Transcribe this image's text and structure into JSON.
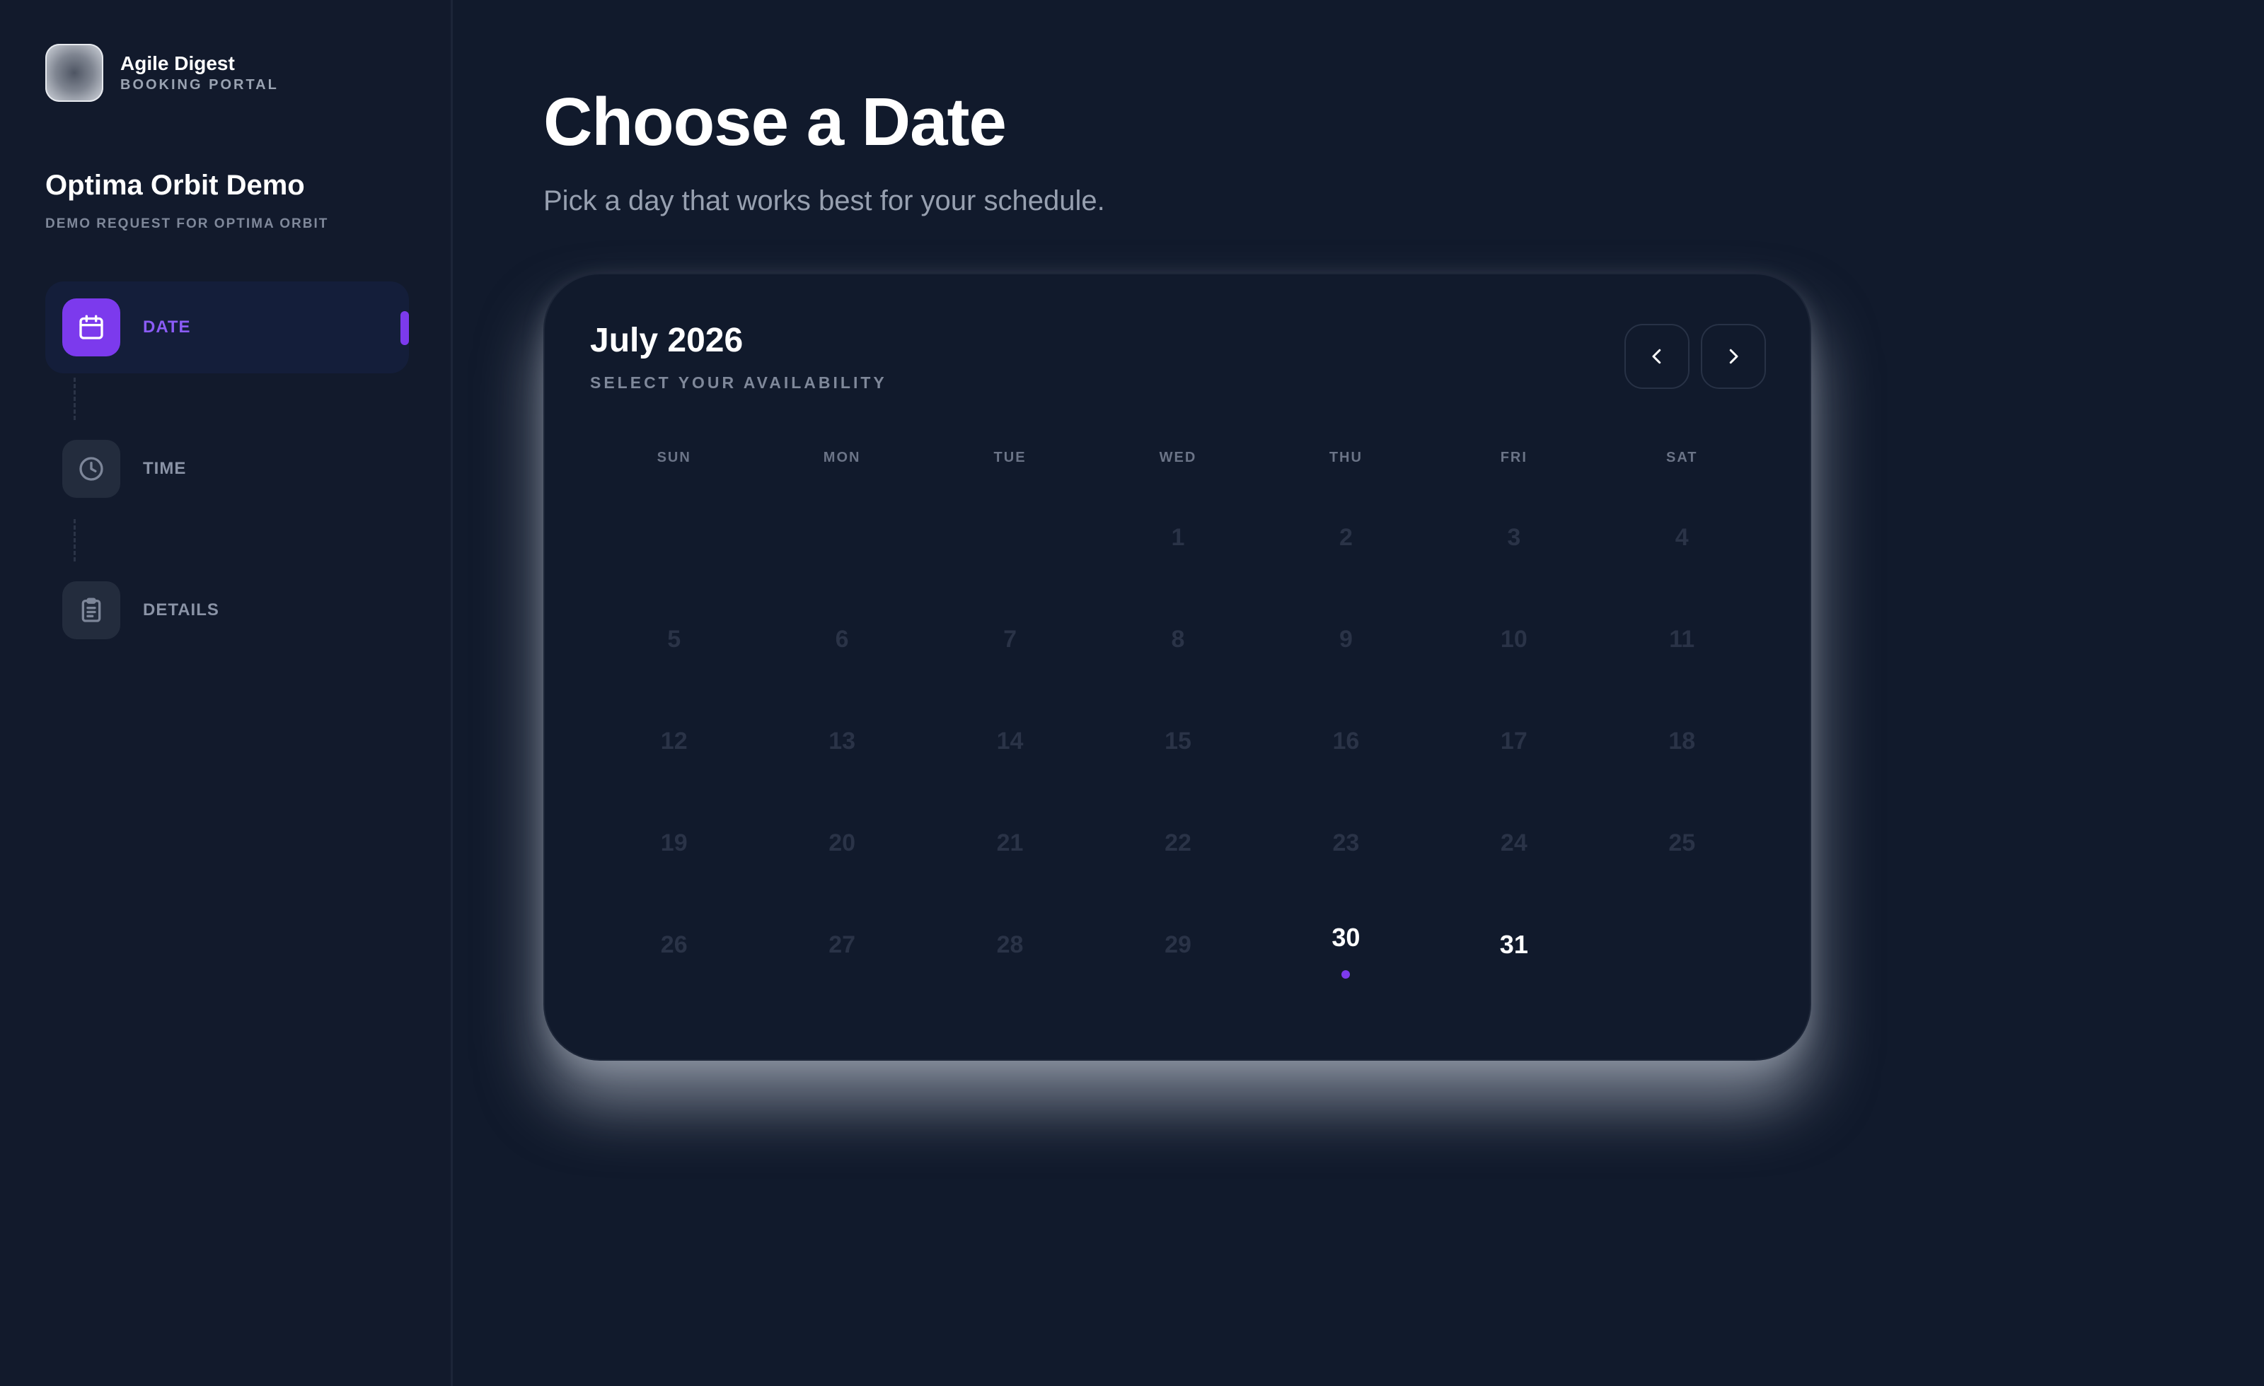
{
  "brand": {
    "name": "Agile Digest",
    "subtitle": "BOOKING PORTAL"
  },
  "event": {
    "title": "Optima Orbit Demo",
    "subtitle": "DEMO REQUEST FOR OPTIMA ORBIT"
  },
  "steps": [
    {
      "label": "DATE",
      "icon": "calendar-icon",
      "active": true
    },
    {
      "label": "TIME",
      "icon": "clock-icon",
      "active": false
    },
    {
      "label": "DETAILS",
      "icon": "clipboard-icon",
      "active": false
    }
  ],
  "page": {
    "title": "Choose a Date",
    "subtitle": "Pick a day that works best for your schedule."
  },
  "calendar": {
    "month_label": "July 2026",
    "subtitle": "SELECT YOUR AVAILABILITY",
    "prev_icon": "chevron-left-icon",
    "next_icon": "chevron-right-icon",
    "weekdays": [
      "SUN",
      "MON",
      "TUE",
      "WED",
      "THU",
      "FRI",
      "SAT"
    ],
    "leading_blanks": 3,
    "days_in_month": 31,
    "available_days": [
      30,
      31
    ],
    "highlighted_days": [
      30
    ]
  },
  "colors": {
    "background": "#111a2c",
    "accent": "#7c3aed",
    "accent_text": "#8b5cf6",
    "disabled_day": "#2a3347",
    "muted_text": "#7f889a"
  }
}
